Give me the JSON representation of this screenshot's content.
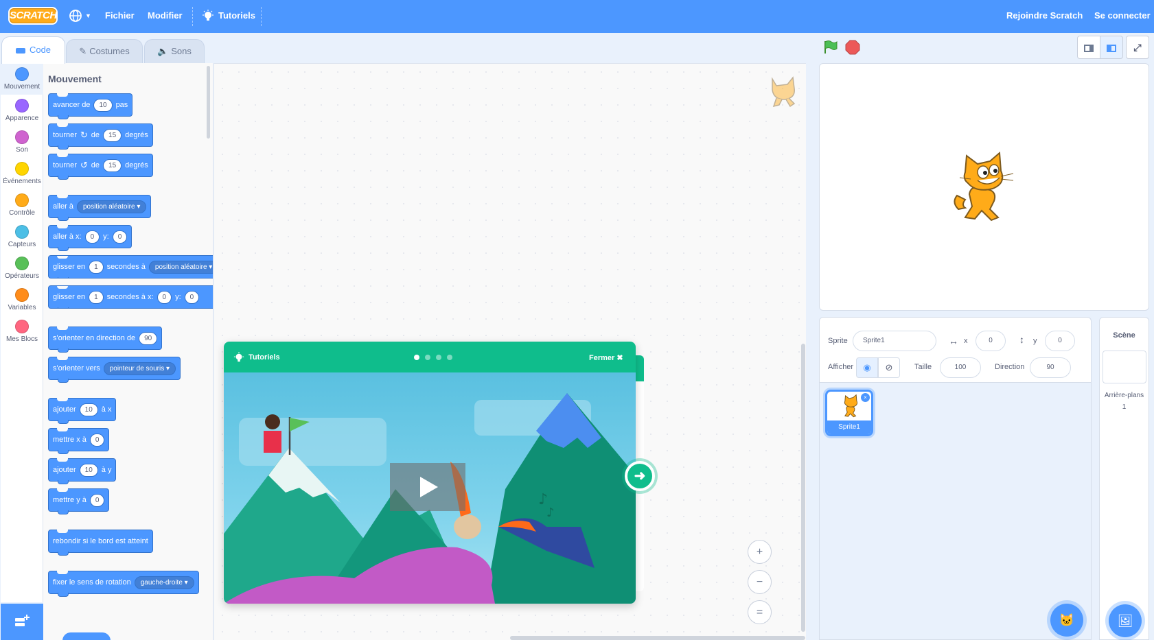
{
  "menubar": {
    "logo": "SCRATCH",
    "file": "Fichier",
    "edit": "Modifier",
    "tutorials": "Tutoriels",
    "join": "Rejoindre Scratch",
    "signin": "Se connecter"
  },
  "tabs": {
    "code": "Code",
    "costumes": "Costumes",
    "sounds": "Sons"
  },
  "categories": [
    {
      "label": "Mouvement",
      "color": "#4c97ff"
    },
    {
      "label": "Apparence",
      "color": "#9966ff"
    },
    {
      "label": "Son",
      "color": "#cf63cf"
    },
    {
      "label": "Événements",
      "color": "#ffd500"
    },
    {
      "label": "Contrôle",
      "color": "#ffab19"
    },
    {
      "label": "Capteurs",
      "color": "#4cbfe6"
    },
    {
      "label": "Opérateurs",
      "color": "#59c059"
    },
    {
      "label": "Variables",
      "color": "#ff8c1a"
    },
    {
      "label": "Mes Blocs",
      "color": "#ff6680"
    }
  ],
  "palette": {
    "section": "Mouvement",
    "b1": {
      "t1": "avancer de",
      "v1": "10",
      "t2": "pas"
    },
    "b2": {
      "t1": "tourner",
      "t2": "de",
      "v1": "15",
      "t3": "degrés"
    },
    "b3": {
      "t1": "tourner",
      "t2": "de",
      "v1": "15",
      "t3": "degrés"
    },
    "b4": {
      "t1": "aller à",
      "d1": "position aléatoire"
    },
    "b5": {
      "t1": "aller à x:",
      "v1": "0",
      "t2": "y:",
      "v2": "0"
    },
    "b6": {
      "t1": "glisser en",
      "v1": "1",
      "t2": "secondes à",
      "d1": "position aléatoire"
    },
    "b7": {
      "t1": "glisser en",
      "v1": "1",
      "t2": "secondes à x:",
      "v2": "0",
      "t3": "y:",
      "v3": "0"
    },
    "b8": {
      "t1": "s'orienter en direction de",
      "v1": "90"
    },
    "b9": {
      "t1": "s'orienter vers",
      "d1": "pointeur de souris"
    },
    "b10": {
      "t1": "ajouter",
      "v1": "10",
      "t2": "à x"
    },
    "b11": {
      "t1": "mettre x à",
      "v1": "0"
    },
    "b12": {
      "t1": "ajouter",
      "v1": "10",
      "t2": "à y"
    },
    "b13": {
      "t1": "mettre y à",
      "v1": "0"
    },
    "b14": {
      "t1": "rebondir si le bord est atteint"
    },
    "b15": {
      "t1": "fixer le sens de rotation",
      "d1": "gauche-droite"
    }
  },
  "tutorial": {
    "title": "Tutoriels",
    "close": "Fermer",
    "page": 1,
    "pages": 4
  },
  "workspace": {
    "zoom_in": "+",
    "zoom_out": "−",
    "zoom_reset": "="
  },
  "sprite": {
    "label": "Sprite",
    "name": "Sprite1",
    "x_label": "x",
    "x": "0",
    "y_label": "y",
    "y": "0",
    "show_label": "Afficher",
    "size_label": "Taille",
    "size": "100",
    "direction_label": "Direction",
    "direction": "90",
    "thumb_name": "Sprite1"
  },
  "stage_panel": {
    "title": "Scène",
    "backdrops_label": "Arrière-plans",
    "backdrops_count": "1"
  }
}
